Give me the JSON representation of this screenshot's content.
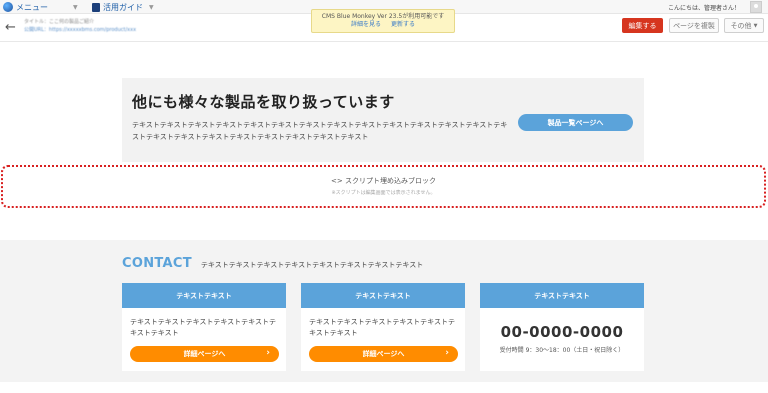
{
  "topbar": {
    "menu_label": "メニュー",
    "guide_label": "活用ガイド",
    "user_greeting": "こんにちは、管理者さん！"
  },
  "admin_bar": {
    "page_info_line1": "タイトル：ここ何の製品ご紹介",
    "page_info_line2": "公開URL：https://xxxxxbms.com/product/xxx",
    "notice_line1": "CMS Blue Monkey Ver 23.5が利用可能です",
    "notice_link1": "詳細を見る",
    "notice_link2": "更新する",
    "edit_button": "編集する",
    "copy_button": "ページを複製",
    "other_button": "その他"
  },
  "products": {
    "heading": "他にも様々な製品を取り扱っています",
    "body": "テキストテキストテキストテキストテキストテキストテキストテキストテキストテキストテキストテキストテキストテキストテキストテキストテキストテキストテキストテキストテキストテキスト",
    "button": "製品一覧ページへ"
  },
  "script_block": {
    "title": "<> スクリプト埋め込みブロック",
    "note": "※スクリプトは編集画面では表示されません。"
  },
  "contact": {
    "title": "CONTACT",
    "text": "テキストテキストテキストテキストテキストテキストテキストテキスト",
    "cards": [
      {
        "head": "テキストテキスト",
        "body": "テキストテキストテキストテキストテキストテキストテキスト",
        "button": "詳細ページへ"
      },
      {
        "head": "テキストテキスト",
        "body": "テキストテキストテキストテキストテキストテキストテキスト",
        "button": "詳細ページへ"
      },
      {
        "head": "テキストテキスト",
        "phone": "00-0000-0000",
        "hours": "受付時間 9：30〜18：00（土日・祝日除く）"
      }
    ]
  },
  "colors": {
    "accent_blue": "#5ba3da",
    "accent_orange": "#ff8c00",
    "edit_red": "#d6351f",
    "notice_yellow": "#fdf5c4"
  }
}
